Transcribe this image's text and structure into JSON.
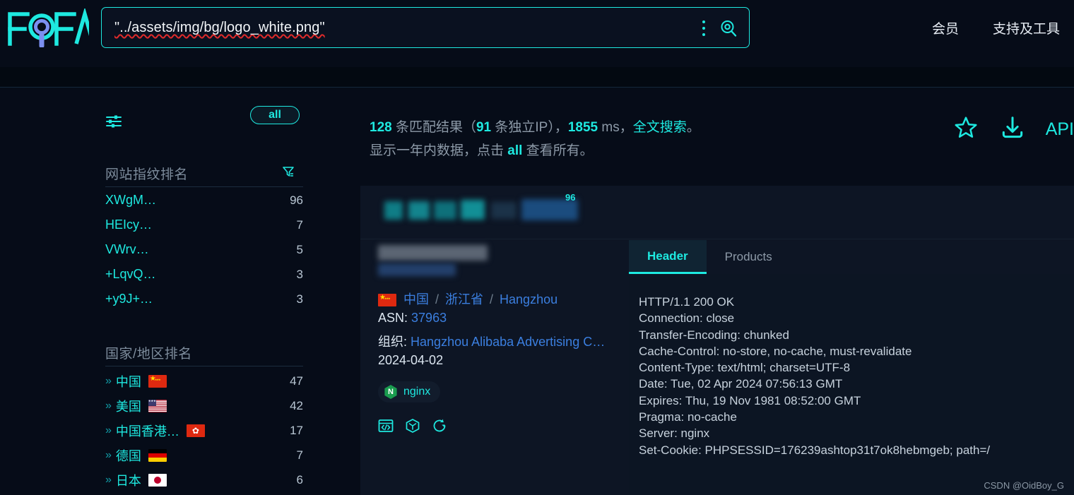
{
  "brand": {
    "name": "FOFA"
  },
  "search": {
    "query": "\"../assets/img/bg/logo_white.png\"",
    "more_icon": "vertical-dots-icon",
    "submit_icon": "search-icon"
  },
  "nav": {
    "items": [
      {
        "label": "会员"
      },
      {
        "label": "支持及工具"
      }
    ]
  },
  "summary": {
    "total": "128",
    "total_suffix": " 条匹配结果（",
    "unique_ip": "91",
    "unique_suffix": " 条独立IP），",
    "time_ms": "1855",
    "time_unit": " ms，",
    "fulltext_link": "全文搜索",
    "line1_end": "。",
    "line2_pre": "显示一年内数据，点击 ",
    "line2_link": "all",
    "line2_post": " 查看所有。"
  },
  "top_actions": {
    "favorite_icon": "star-icon",
    "download_icon": "download-icon",
    "api_label": "API"
  },
  "sidebar": {
    "settings_icon": "sliders-icon",
    "all_button": "all",
    "fingerprint": {
      "title": "网站指纹排名",
      "filter_icon": "funnel-icon",
      "rows": [
        {
          "label": "XWgM…",
          "count": "96"
        },
        {
          "label": "HEIcy…",
          "count": "7"
        },
        {
          "label": "VWrv…",
          "count": "5"
        },
        {
          "label": "+LqvQ…",
          "count": "3"
        },
        {
          "label": "+y9J+…",
          "count": "3"
        }
      ]
    },
    "country": {
      "title": "国家/地区排名",
      "rows": [
        {
          "label": "中国",
          "flag": "cn",
          "count": "47"
        },
        {
          "label": "美国",
          "flag": "us",
          "count": "42"
        },
        {
          "label": "中国香港…",
          "flag": "hk",
          "count": "17"
        },
        {
          "label": "德国",
          "flag": "de",
          "count": "7"
        },
        {
          "label": "日本",
          "flag": "jp",
          "count": "6"
        }
      ]
    }
  },
  "result": {
    "banner_badge": "96",
    "location": {
      "country": "中国",
      "province": "浙江省",
      "city": "Hangzhou",
      "separator": "/"
    },
    "asn_label": "ASN:",
    "asn_value": "37963",
    "org_label": "组织:",
    "org_value": "Hangzhou Alibaba Advertising C…",
    "date": "2024-04-02",
    "product": {
      "name": "nginx",
      "initial": "N"
    },
    "action_icons": [
      "source-code-icon",
      "cube-icon",
      "refresh-icon"
    ],
    "tabs": [
      {
        "label": "Header",
        "active": true
      },
      {
        "label": "Products",
        "active": false
      }
    ],
    "headers": [
      "HTTP/1.1 200 OK",
      "Connection: close",
      "Transfer-Encoding: chunked",
      "Cache-Control: no-store, no-cache, must-revalidate",
      "Content-Type: text/html; charset=UTF-8",
      "Date: Tue, 02 Apr 2024 07:56:13 GMT",
      "Expires: Thu, 19 Nov 1981 08:52:00 GMT",
      "Pragma: no-cache",
      "Server: nginx",
      "Set-Cookie: PHPSESSID=176239ashtop31t7ok8hebmgeb; path=/"
    ]
  },
  "watermark": "CSDN @OidBoy_G",
  "colors": {
    "accent": "#1ee9e0",
    "link": "#3b7fe0",
    "bg": "#060c18",
    "card_bg": "#0d1524"
  }
}
